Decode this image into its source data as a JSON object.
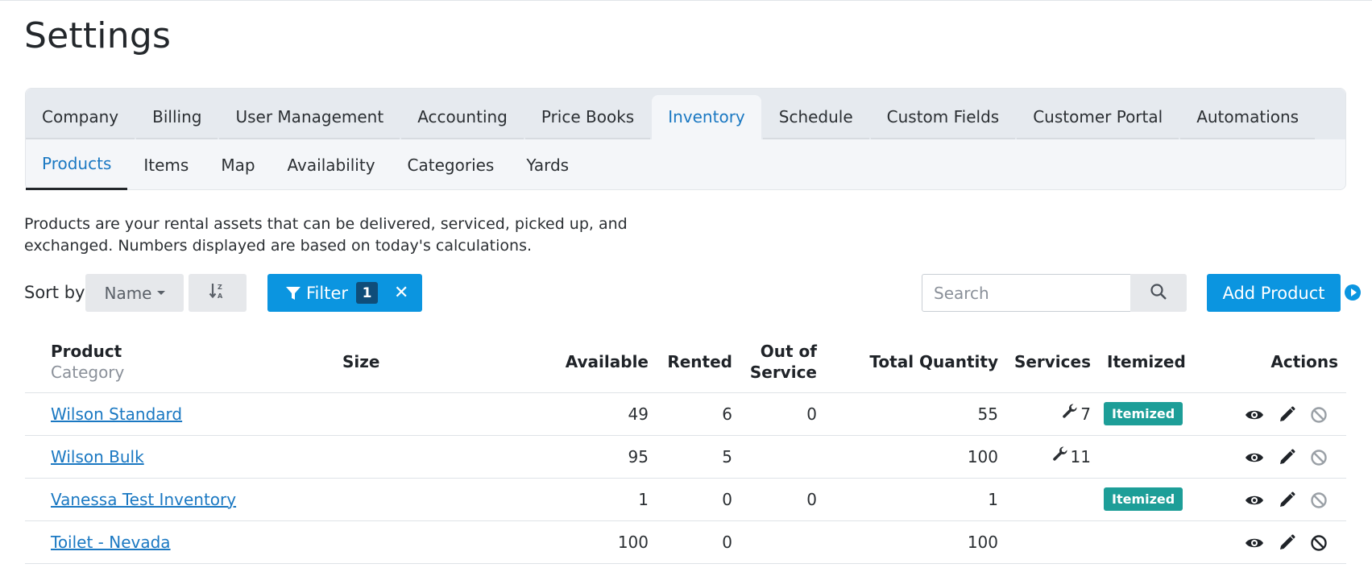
{
  "page_title": "Settings",
  "main_tabs": [
    "Company",
    "Billing",
    "User Management",
    "Accounting",
    "Price Books",
    "Inventory",
    "Schedule",
    "Custom Fields",
    "Customer Portal",
    "Automations"
  ],
  "main_tab_active": "Inventory",
  "sub_tabs": [
    "Products",
    "Items",
    "Map",
    "Availability",
    "Categories",
    "Yards"
  ],
  "sub_tab_active": "Products",
  "description": "Products are your rental assets that can be delivered, serviced, picked up, and exchanged. Numbers displayed are based on today's calculations.",
  "toolbar": {
    "sort_label": "Sort by",
    "sort_value": "Name",
    "filter_label": "Filter",
    "filter_count": "1",
    "search_placeholder": "Search",
    "add_label": "Add Product"
  },
  "table": {
    "headers": {
      "product": "Product",
      "category": "Category",
      "size": "Size",
      "available": "Available",
      "rented": "Rented",
      "out_of_service_1": "Out of",
      "out_of_service_2": "Service",
      "total_quantity": "Total Quantity",
      "services": "Services",
      "itemized": "Itemized",
      "actions": "Actions"
    },
    "rows": [
      {
        "name": "Wilson Standard",
        "available": "49",
        "rented": "6",
        "out_of_service": "0",
        "total": "55",
        "services": "7",
        "itemized": "Itemized",
        "disable_active": false
      },
      {
        "name": "Wilson Bulk",
        "available": "95",
        "rented": "5",
        "out_of_service": "",
        "total": "100",
        "services": "11",
        "itemized": "",
        "disable_active": false
      },
      {
        "name": "Vanessa Test Inventory",
        "available": "1",
        "rented": "0",
        "out_of_service": "0",
        "total": "1",
        "services": "",
        "itemized": "Itemized",
        "disable_active": false
      },
      {
        "name": "Toilet - Nevada",
        "available": "100",
        "rented": "0",
        "out_of_service": "",
        "total": "100",
        "services": "",
        "itemized": "",
        "disable_active": true
      }
    ]
  },
  "colors": {
    "accent": "#0b95e0",
    "link": "#1a78c2",
    "badge": "#1d9e98"
  },
  "icons": {
    "sort_dir": "sort-alpha-down-icon",
    "filter": "filter-icon",
    "search": "search-icon",
    "service": "wrench-icon",
    "view": "eye-icon",
    "edit": "pencil-icon",
    "disable": "ban-icon",
    "tour": "play-circle-icon"
  }
}
